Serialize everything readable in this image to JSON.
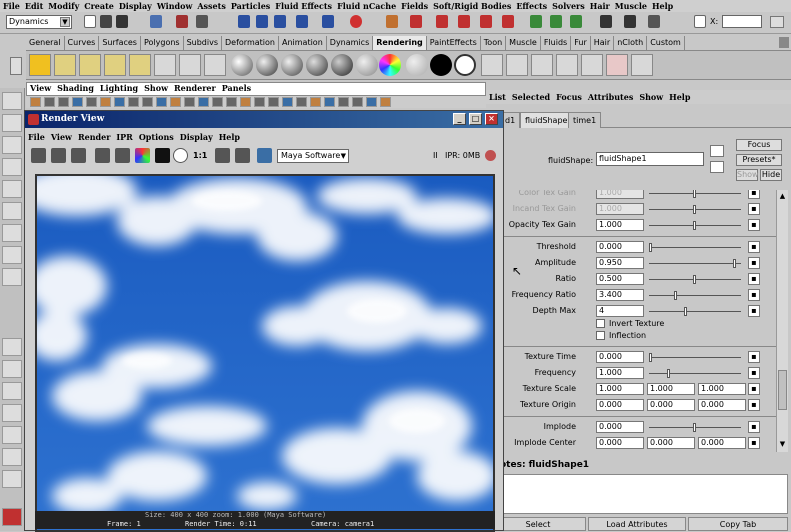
{
  "menubar": [
    "File",
    "Edit",
    "Modify",
    "Create",
    "Display",
    "Window",
    "Assets",
    "Particles",
    "Fluid Effects",
    "Fluid nCache",
    "Fields",
    "Soft/Rigid Bodies",
    "Effects",
    "Solvers",
    "Hair",
    "Muscle",
    "Help"
  ],
  "status": {
    "mode": "Dynamics",
    "x_label": "X:"
  },
  "shelf_tabs": [
    "General",
    "Curves",
    "Surfaces",
    "Polygons",
    "Subdivs",
    "Deformation",
    "Animation",
    "Dynamics",
    "Rendering",
    "PaintEffects",
    "Toon",
    "Muscle",
    "Fluids",
    "Fur",
    "Hair",
    "nCloth",
    "Custom"
  ],
  "active_shelf_tab": "Rendering",
  "panel_menu": [
    "View",
    "Shading",
    "Lighting",
    "Show",
    "Renderer",
    "Panels"
  ],
  "render_view": {
    "title": "Render View",
    "menu": [
      "File",
      "View",
      "Render",
      "IPR",
      "Options",
      "Display",
      "Help"
    ],
    "ratio_label": "1:1",
    "camera": "Maya Software",
    "ipr_label": "IPR: 0MB",
    "size_text": "Size:  400 x 400  zoom: 1.000        (Maya Software)",
    "frame_text": "Frame: 1",
    "render_time": "Render Time: 0:11",
    "camera_text": "Camera: camera1"
  },
  "attr_editor": {
    "menu": [
      "List",
      "Selected",
      "Focus",
      "Attributes",
      "Show",
      "Help"
    ],
    "tabs": [
      "d1",
      "fluidShape1",
      "time1"
    ],
    "active_tab": "fluidShape1",
    "node_label": "fluidShape:",
    "node_value": "fluidShape1",
    "focus_btn": "Focus",
    "presets_btn": "Presets*",
    "show_btn": "Show",
    "hide_btn": "Hide",
    "rows_a": [
      {
        "label": "Color Tex Gain",
        "value": "1.000",
        "dim": true,
        "slider": 0.5
      },
      {
        "label": "Incand Tex Gain",
        "value": "1.000",
        "dim": true,
        "slider": 0.5
      },
      {
        "label": "Opacity Tex Gain",
        "value": "1.000",
        "dim": false,
        "slider": 0.5
      }
    ],
    "rows_b": [
      {
        "label": "Threshold",
        "value": "0.000",
        "slider": 0.0
      },
      {
        "label": "Amplitude",
        "value": "0.950",
        "slider": 0.95
      },
      {
        "label": "Ratio",
        "value": "0.500",
        "slider": 0.5
      },
      {
        "label": "Frequency Ratio",
        "value": "3.400",
        "slider": 0.28
      },
      {
        "label": "Depth Max",
        "value": "4",
        "slider": 0.4
      }
    ],
    "checks": [
      {
        "label": "Invert Texture"
      },
      {
        "label": "Inflection"
      }
    ],
    "rows_c": [
      {
        "label": "Texture Time",
        "value": "0.000",
        "slider": 0.0
      },
      {
        "label": "Frequency",
        "value": "1.000",
        "slider": 0.2
      },
      {
        "label": "Texture Scale",
        "v1": "1.000",
        "v2": "1.000",
        "v3": "1.000"
      },
      {
        "label": "Texture Origin",
        "v1": "0.000",
        "v2": "0.000",
        "v3": "0.000"
      }
    ],
    "rows_d": [
      {
        "label": "Implode",
        "value": "0.000",
        "slider": 0.5
      },
      {
        "label": "Implode Center",
        "v1": "0.000",
        "v2": "0.000",
        "v3": "0.000"
      }
    ],
    "notes_label": "otes:  fluidShape1",
    "select_btn": "Select",
    "load_btn": "Load Attributes",
    "copy_btn": "Copy Tab"
  }
}
